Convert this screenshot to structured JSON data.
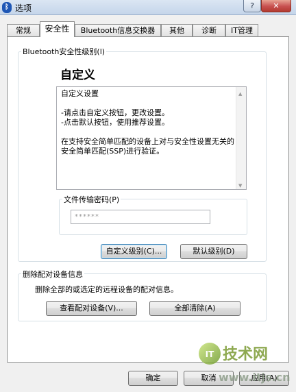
{
  "window": {
    "title": "选项",
    "help_glyph": "?",
    "close_glyph": "✕"
  },
  "tabs": [
    "常规",
    "安全性",
    "Bluetooth信息交换器",
    "其他",
    "诊断",
    "IT管理"
  ],
  "security": {
    "group_label": "Bluetooth安全性级别(l)",
    "level_name": "自定义",
    "description": "自定义设置\n\n-请点击自定义按钮，更改设置。\n-点击默认按钮，使用推荐设置。\n\n在支持安全简单匹配的设备上对与安全性设置无关的安全简单匹配(SSP)进行验证。",
    "password_group_label": "文件传输密码(P)",
    "password_value": "******",
    "custom_level_button": "自定义级别(C)...",
    "default_level_button": "默认级别(D)"
  },
  "pairing": {
    "group_label": "删除配对设备信息",
    "description": "删除全部的或选定的远程设备的配对信息。",
    "view_button": "查看配对设备(V)...",
    "clear_all_button": "全部清除(A)"
  },
  "footer": {
    "ok": "确定",
    "cancel": "取消",
    "apply": "应用(A)"
  },
  "watermark": {
    "badge": "IT",
    "site_name": "技术网",
    "url": "www.itjs.cn"
  }
}
